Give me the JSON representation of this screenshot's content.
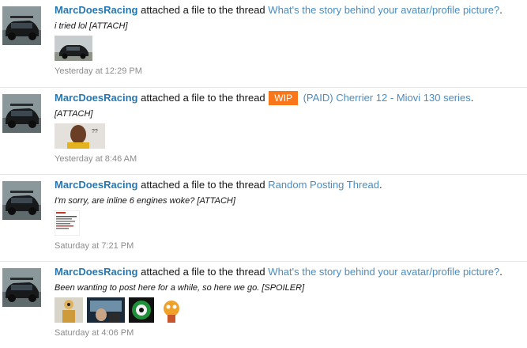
{
  "activity": [
    {
      "user": "MarcDoesRacing",
      "action": "attached a file to the thread",
      "badge": "",
      "thread": "What's the story behind your avatar/profile picture?",
      "punct": ".",
      "snippet": "i tried lol [ATTACH]",
      "thumbs": [
        "car-photo-thumbnail"
      ],
      "date": "Yesterday at 12:29 PM"
    },
    {
      "user": "MarcDoesRacing",
      "action": "attached a file to the thread",
      "badge": "WIP",
      "thread": "(PAID) Cherrier 12 - Miovi 130 series",
      "punct": ".",
      "snippet": "[ATTACH]",
      "thumbs": [
        "person-meme-thumbnail"
      ],
      "date": "Yesterday at 8:46 AM"
    },
    {
      "user": "MarcDoesRacing",
      "action": "attached a file to the thread",
      "badge": "",
      "thread": "Random Posting Thread",
      "punct": ".",
      "snippet": "I'm sorry, are inline 6 engines woke? [ATTACH]",
      "thumbs": [
        "article-screenshot-thumbnail"
      ],
      "date": "Saturday at 7:21 PM"
    },
    {
      "user": "MarcDoesRacing",
      "action": "attached a file to the thread",
      "badge": "",
      "thread": "What's the story behind your avatar/profile picture?",
      "punct": ".",
      "snippet": "Been wanting to post here for a while, so here we go. [SPOILER]",
      "thumbs": [
        "crash-test-dummy-thumbnail",
        "car-interior-thumbnail",
        "green-badge-thumbnail",
        "cartoon-cat-thumbnail"
      ],
      "date": "Saturday at 4:06 PM"
    }
  ],
  "colors": {
    "user": "#2577b1",
    "thread": "#4a8cc0",
    "badge": "#f9761a",
    "date": "#8c8c8c"
  }
}
